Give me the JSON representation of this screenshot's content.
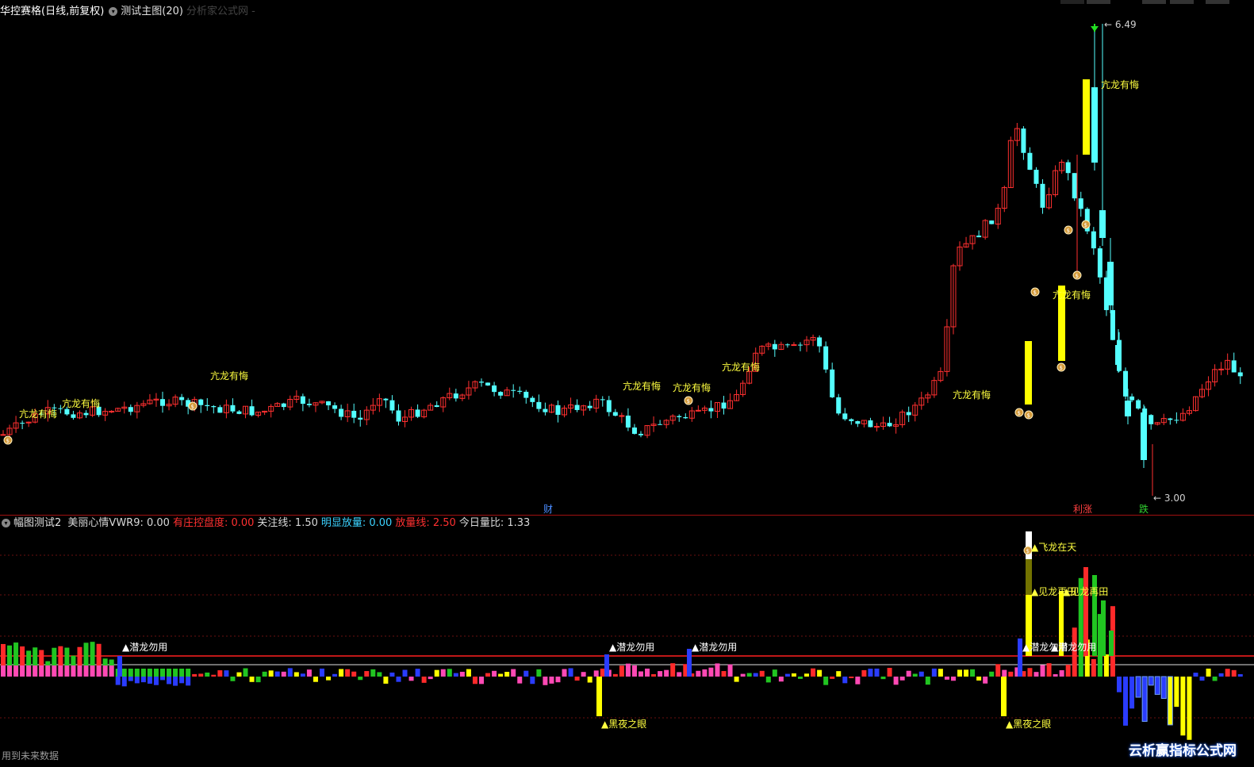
{
  "main_header": {
    "stock": "华控赛格(日线,前复权)",
    "indicator": "测试主图(20)",
    "source": "分析家公式网 -"
  },
  "sub_header": {
    "panel": "幅图测试2",
    "items": [
      {
        "label": "美丽心情VWR9:",
        "value": "0.00",
        "color": "#d8d8d8"
      },
      {
        "label": "有庄控盘度:",
        "value": "0.00",
        "color": "#ff3030"
      },
      {
        "label": "关注线:",
        "value": "1.50",
        "color": "#d8d8d8"
      },
      {
        "label": "明显放量:",
        "value": "0.00",
        "color": "#3cd2ff"
      },
      {
        "label": "放量线:",
        "value": "2.50",
        "color": "#ff3030"
      },
      {
        "label": "今日量比:",
        "value": "1.33",
        "color": "#d8d8d8"
      }
    ]
  },
  "footer_note": "用到未来数据",
  "watermark": "云析赢指标公式网",
  "chart_data": {
    "type": "candlestick",
    "candles_pattern_label": "亢龙有悔",
    "high_label": "6.49",
    "low_label": "3.00",
    "bottom_tags": [
      {
        "text": "财",
        "color": "#4a8cff"
      },
      {
        "text": "涨",
        "color": "#ff4040"
      },
      {
        "text": "跌",
        "color": "#30d030"
      }
    ],
    "signals": [
      "潜龙勿用",
      "黑夜之眼",
      "见龙再田",
      "飞龙在天"
    ],
    "colors": {
      "up": "#ff3030",
      "down": "#54ffff",
      "highlight": "#ffff00",
      "label": "#ffff40"
    }
  }
}
